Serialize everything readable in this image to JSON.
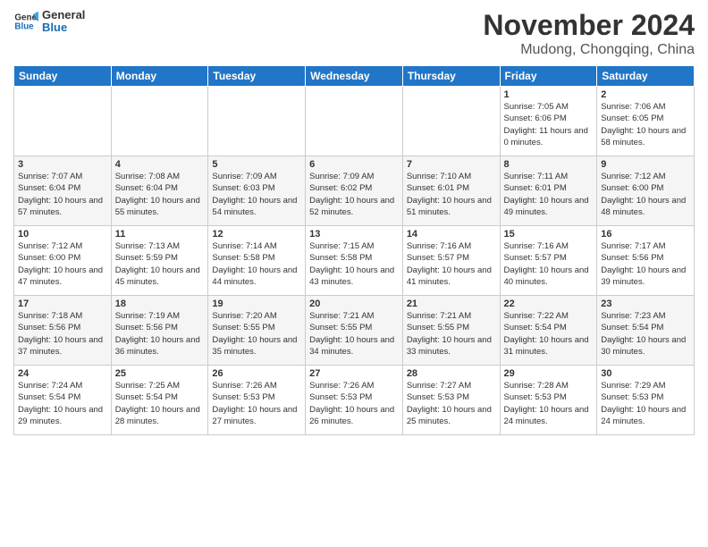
{
  "logo": {
    "line1": "General",
    "line2": "Blue"
  },
  "title": "November 2024",
  "location": "Mudong, Chongqing, China",
  "weekdays": [
    "Sunday",
    "Monday",
    "Tuesday",
    "Wednesday",
    "Thursday",
    "Friday",
    "Saturday"
  ],
  "weeks": [
    [
      {
        "day": "",
        "info": ""
      },
      {
        "day": "",
        "info": ""
      },
      {
        "day": "",
        "info": ""
      },
      {
        "day": "",
        "info": ""
      },
      {
        "day": "",
        "info": ""
      },
      {
        "day": "1",
        "info": "Sunrise: 7:05 AM\nSunset: 6:06 PM\nDaylight: 11 hours and 0 minutes."
      },
      {
        "day": "2",
        "info": "Sunrise: 7:06 AM\nSunset: 6:05 PM\nDaylight: 10 hours and 58 minutes."
      }
    ],
    [
      {
        "day": "3",
        "info": "Sunrise: 7:07 AM\nSunset: 6:04 PM\nDaylight: 10 hours and 57 minutes."
      },
      {
        "day": "4",
        "info": "Sunrise: 7:08 AM\nSunset: 6:04 PM\nDaylight: 10 hours and 55 minutes."
      },
      {
        "day": "5",
        "info": "Sunrise: 7:09 AM\nSunset: 6:03 PM\nDaylight: 10 hours and 54 minutes."
      },
      {
        "day": "6",
        "info": "Sunrise: 7:09 AM\nSunset: 6:02 PM\nDaylight: 10 hours and 52 minutes."
      },
      {
        "day": "7",
        "info": "Sunrise: 7:10 AM\nSunset: 6:01 PM\nDaylight: 10 hours and 51 minutes."
      },
      {
        "day": "8",
        "info": "Sunrise: 7:11 AM\nSunset: 6:01 PM\nDaylight: 10 hours and 49 minutes."
      },
      {
        "day": "9",
        "info": "Sunrise: 7:12 AM\nSunset: 6:00 PM\nDaylight: 10 hours and 48 minutes."
      }
    ],
    [
      {
        "day": "10",
        "info": "Sunrise: 7:12 AM\nSunset: 6:00 PM\nDaylight: 10 hours and 47 minutes."
      },
      {
        "day": "11",
        "info": "Sunrise: 7:13 AM\nSunset: 5:59 PM\nDaylight: 10 hours and 45 minutes."
      },
      {
        "day": "12",
        "info": "Sunrise: 7:14 AM\nSunset: 5:58 PM\nDaylight: 10 hours and 44 minutes."
      },
      {
        "day": "13",
        "info": "Sunrise: 7:15 AM\nSunset: 5:58 PM\nDaylight: 10 hours and 43 minutes."
      },
      {
        "day": "14",
        "info": "Sunrise: 7:16 AM\nSunset: 5:57 PM\nDaylight: 10 hours and 41 minutes."
      },
      {
        "day": "15",
        "info": "Sunrise: 7:16 AM\nSunset: 5:57 PM\nDaylight: 10 hours and 40 minutes."
      },
      {
        "day": "16",
        "info": "Sunrise: 7:17 AM\nSunset: 5:56 PM\nDaylight: 10 hours and 39 minutes."
      }
    ],
    [
      {
        "day": "17",
        "info": "Sunrise: 7:18 AM\nSunset: 5:56 PM\nDaylight: 10 hours and 37 minutes."
      },
      {
        "day": "18",
        "info": "Sunrise: 7:19 AM\nSunset: 5:56 PM\nDaylight: 10 hours and 36 minutes."
      },
      {
        "day": "19",
        "info": "Sunrise: 7:20 AM\nSunset: 5:55 PM\nDaylight: 10 hours and 35 minutes."
      },
      {
        "day": "20",
        "info": "Sunrise: 7:21 AM\nSunset: 5:55 PM\nDaylight: 10 hours and 34 minutes."
      },
      {
        "day": "21",
        "info": "Sunrise: 7:21 AM\nSunset: 5:55 PM\nDaylight: 10 hours and 33 minutes."
      },
      {
        "day": "22",
        "info": "Sunrise: 7:22 AM\nSunset: 5:54 PM\nDaylight: 10 hours and 31 minutes."
      },
      {
        "day": "23",
        "info": "Sunrise: 7:23 AM\nSunset: 5:54 PM\nDaylight: 10 hours and 30 minutes."
      }
    ],
    [
      {
        "day": "24",
        "info": "Sunrise: 7:24 AM\nSunset: 5:54 PM\nDaylight: 10 hours and 29 minutes."
      },
      {
        "day": "25",
        "info": "Sunrise: 7:25 AM\nSunset: 5:54 PM\nDaylight: 10 hours and 28 minutes."
      },
      {
        "day": "26",
        "info": "Sunrise: 7:26 AM\nSunset: 5:53 PM\nDaylight: 10 hours and 27 minutes."
      },
      {
        "day": "27",
        "info": "Sunrise: 7:26 AM\nSunset: 5:53 PM\nDaylight: 10 hours and 26 minutes."
      },
      {
        "day": "28",
        "info": "Sunrise: 7:27 AM\nSunset: 5:53 PM\nDaylight: 10 hours and 25 minutes."
      },
      {
        "day": "29",
        "info": "Sunrise: 7:28 AM\nSunset: 5:53 PM\nDaylight: 10 hours and 24 minutes."
      },
      {
        "day": "30",
        "info": "Sunrise: 7:29 AM\nSunset: 5:53 PM\nDaylight: 10 hours and 24 minutes."
      }
    ]
  ]
}
